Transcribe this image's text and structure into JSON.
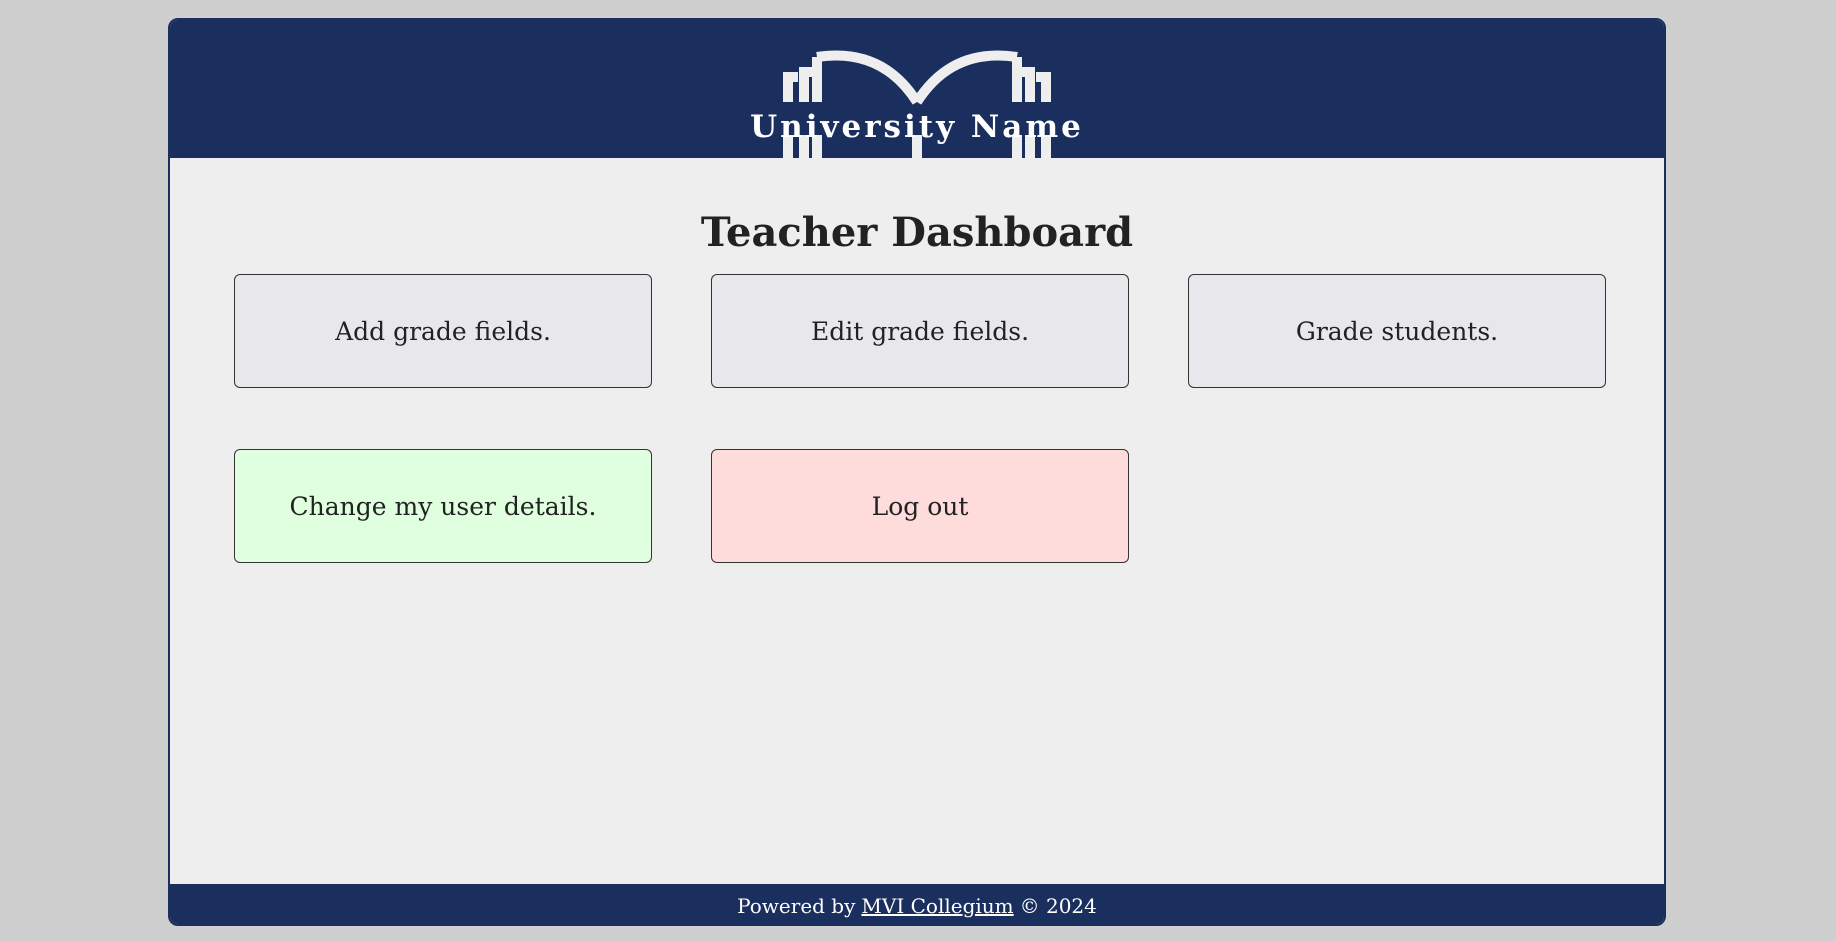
{
  "header": {
    "university_name": "University Name",
    "logo_icon": "university-building-icon",
    "background_color": "#1b2f5e"
  },
  "main": {
    "title": "Teacher Dashboard",
    "tiles": [
      {
        "label": "Add grade fields.",
        "color": "#e8e8ec"
      },
      {
        "label": "Edit grade fields.",
        "color": "#e8e8ec"
      },
      {
        "label": "Grade students.",
        "color": "#e8e8ec"
      },
      {
        "label": "Change my user details.",
        "color": "#dfffdf"
      },
      {
        "label": "Log out",
        "color": "#ffdcdc"
      }
    ]
  },
  "footer": {
    "prefix": "Powered by",
    "link_text": "MVI Collegium",
    "suffix": "© 2024",
    "background_color": "#1b2f5e"
  }
}
